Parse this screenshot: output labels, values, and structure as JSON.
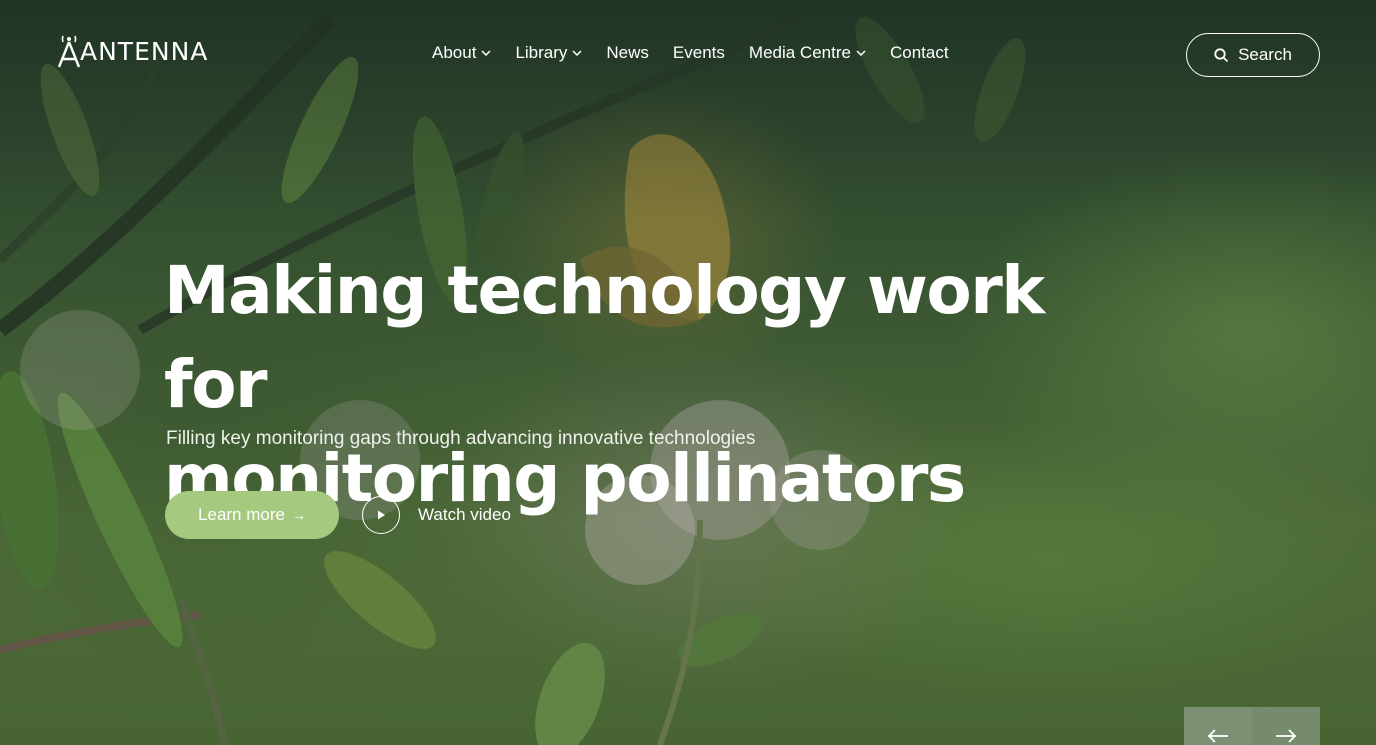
{
  "brand": {
    "name": "ANTENNA"
  },
  "nav": {
    "items": [
      {
        "label": "About",
        "has_dropdown": true
      },
      {
        "label": "Library",
        "has_dropdown": true
      },
      {
        "label": "News",
        "has_dropdown": false
      },
      {
        "label": "Events",
        "has_dropdown": false
      },
      {
        "label": "Media Centre",
        "has_dropdown": true
      },
      {
        "label": "Contact",
        "has_dropdown": false
      }
    ],
    "search_label": "Search"
  },
  "hero": {
    "headline_line1": "Making technology work for",
    "headline_line2": "monitoring pollinators",
    "subheadline": "Filling key monitoring gaps through advancing innovative technologies",
    "primary_cta": "Learn more",
    "primary_cta_arrow": "→",
    "secondary_cta": "Watch video"
  },
  "icons": {
    "logo": "antenna-tower-icon",
    "search": "search-icon",
    "dropdown": "chevron-down-icon",
    "play": "play-icon",
    "prev": "arrow-left-icon",
    "next": "arrow-right-icon"
  },
  "colors": {
    "accent": "#a5c97e",
    "text": "#ffffff",
    "background": "#3c5a34"
  }
}
